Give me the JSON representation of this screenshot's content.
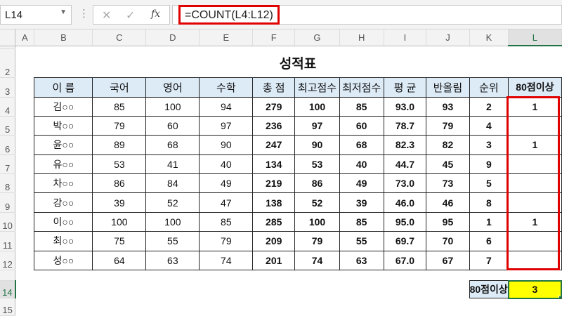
{
  "name_box": "L14",
  "formula": "=COUNT(L4:L12)",
  "columns": [
    "A",
    "B",
    "C",
    "D",
    "E",
    "F",
    "G",
    "H",
    "I",
    "J",
    "K",
    "L"
  ],
  "rows": [
    "2",
    "3",
    "4",
    "5",
    "6",
    "7",
    "8",
    "9",
    "10",
    "11",
    "12",
    "14",
    "15"
  ],
  "title": "성적표",
  "headers": [
    "이 름",
    "국어",
    "영어",
    "수학",
    "총 점",
    "최고점수",
    "최저점수",
    "평 균",
    "반올림",
    "순위",
    "80점이상"
  ],
  "data": [
    [
      "김○○",
      "85",
      "100",
      "94",
      "279",
      "100",
      "85",
      "93.0",
      "93",
      "2",
      "1"
    ],
    [
      "박○○",
      "79",
      "60",
      "97",
      "236",
      "97",
      "60",
      "78.7",
      "79",
      "4",
      ""
    ],
    [
      "윤○○",
      "89",
      "68",
      "90",
      "247",
      "90",
      "68",
      "82.3",
      "82",
      "3",
      "1"
    ],
    [
      "유○○",
      "53",
      "41",
      "40",
      "134",
      "53",
      "40",
      "44.7",
      "45",
      "9",
      ""
    ],
    [
      "차○○",
      "86",
      "84",
      "49",
      "219",
      "86",
      "49",
      "73.0",
      "73",
      "5",
      ""
    ],
    [
      "강○○",
      "39",
      "52",
      "47",
      "138",
      "52",
      "39",
      "46.0",
      "46",
      "8",
      ""
    ],
    [
      "이○○",
      "100",
      "100",
      "85",
      "285",
      "100",
      "85",
      "95.0",
      "95",
      "1",
      "1"
    ],
    [
      "최○○",
      "75",
      "55",
      "79",
      "209",
      "79",
      "55",
      "69.7",
      "70",
      "6",
      ""
    ],
    [
      "성○○",
      "64",
      "63",
      "74",
      "201",
      "74",
      "63",
      "67.0",
      "67",
      "7",
      ""
    ]
  ],
  "summary": {
    "label": "80점이상",
    "value": "3"
  }
}
